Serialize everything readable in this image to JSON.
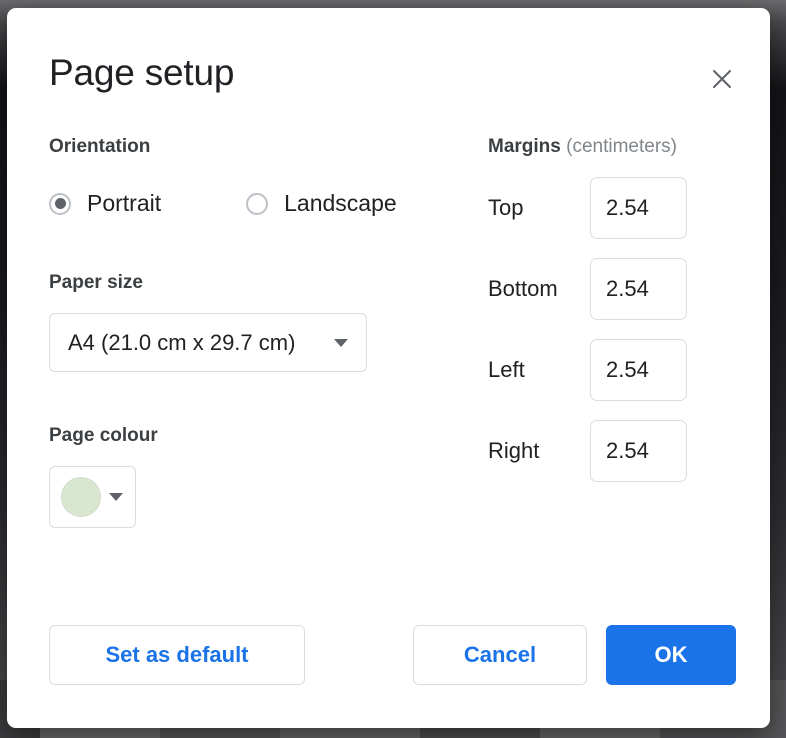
{
  "dialog": {
    "title": "Page setup",
    "close_icon": "close-icon"
  },
  "orientation": {
    "label": "Orientation",
    "options": [
      {
        "label": "Portrait",
        "selected": true
      },
      {
        "label": "Landscape",
        "selected": false
      }
    ]
  },
  "paper_size": {
    "label": "Paper size",
    "value": "A4 (21.0 cm x 29.7 cm)",
    "caret_icon": "chevron-down-icon"
  },
  "page_colour": {
    "label": "Page colour",
    "swatch_color": "#d9e7d0",
    "caret_icon": "chevron-down-icon"
  },
  "margins": {
    "heading_bold": "Margins",
    "heading_unit": "(centimeters)",
    "fields": [
      {
        "label": "Top",
        "value": "2.54"
      },
      {
        "label": "Bottom",
        "value": "2.54"
      },
      {
        "label": "Left",
        "value": "2.54"
      },
      {
        "label": "Right",
        "value": "2.54"
      }
    ]
  },
  "footer": {
    "set_default_label": "Set as default",
    "cancel_label": "Cancel",
    "ok_label": "OK"
  },
  "colors": {
    "accent_blue": "#1a73e8",
    "text_primary": "#202124",
    "text_secondary": "#80868b",
    "border": "#dadce0"
  }
}
